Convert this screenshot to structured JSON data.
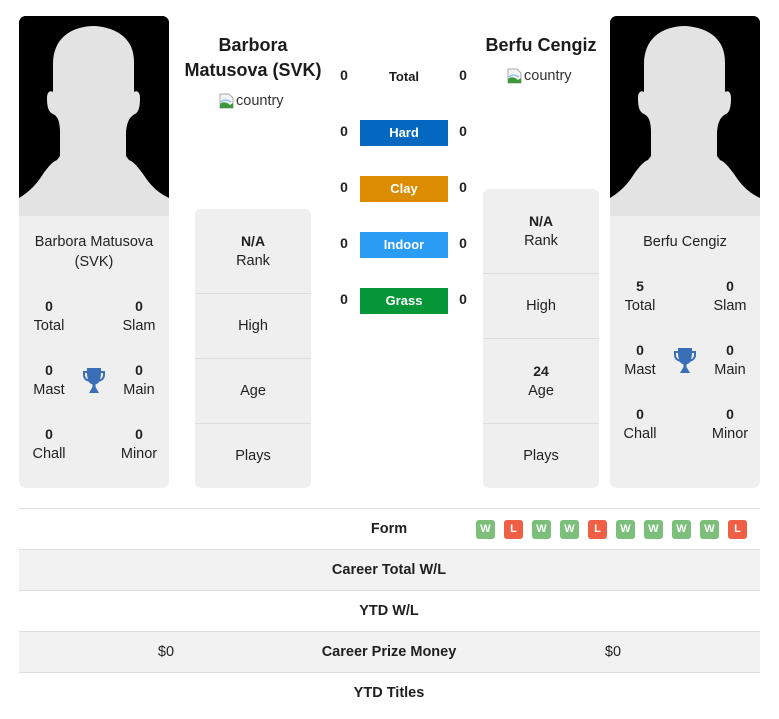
{
  "colors": {
    "hard": "#0568c0",
    "clay": "#dc8c00",
    "indoor": "#2b9cf4",
    "grass": "#059637",
    "win": "#7bbf7b",
    "loss": "#ee5f45",
    "trophy": "#3a6fb8"
  },
  "player_left": {
    "name_header": "Barbora Matusova (SVK)",
    "name_header_line1": "Barbora",
    "name_header_line2": "Matusova (SVK)",
    "flag_alt": "country",
    "card_name_line1": "Barbora Matusova",
    "card_name_line2": "(SVK)",
    "titles": {
      "total": {
        "value": "0",
        "label": "Total"
      },
      "slam": {
        "value": "0",
        "label": "Slam"
      },
      "mast": {
        "value": "0",
        "label": "Mast"
      },
      "main": {
        "value": "0",
        "label": "Main"
      },
      "chall": {
        "value": "0",
        "label": "Chall"
      },
      "minor": {
        "value": "0",
        "label": "Minor"
      }
    },
    "rank": {
      "value": "N/A",
      "label": "Rank"
    },
    "high": {
      "value": "",
      "label": "High"
    },
    "age": {
      "value": "",
      "label": "Age"
    },
    "plays": {
      "value": "",
      "label": "Plays"
    }
  },
  "player_right": {
    "name_header": "Berfu Cengiz",
    "flag_alt": "country",
    "card_name": "Berfu Cengiz",
    "titles": {
      "total": {
        "value": "5",
        "label": "Total"
      },
      "slam": {
        "value": "0",
        "label": "Slam"
      },
      "mast": {
        "value": "0",
        "label": "Mast"
      },
      "main": {
        "value": "0",
        "label": "Main"
      },
      "chall": {
        "value": "0",
        "label": "Chall"
      },
      "minor": {
        "value": "0",
        "label": "Minor"
      }
    },
    "rank": {
      "value": "N/A",
      "label": "Rank"
    },
    "high": {
      "value": "",
      "label": "High"
    },
    "age": {
      "value": "24",
      "label": "Age"
    },
    "plays": {
      "value": "",
      "label": "Plays"
    }
  },
  "h2h": {
    "total": {
      "label": "Total",
      "left": "0",
      "right": "0"
    },
    "hard": {
      "label": "Hard",
      "left": "0",
      "right": "0"
    },
    "clay": {
      "label": "Clay",
      "left": "0",
      "right": "0"
    },
    "indoor": {
      "label": "Indoor",
      "left": "0",
      "right": "0"
    },
    "grass": {
      "label": "Grass",
      "left": "0",
      "right": "0"
    }
  },
  "table": {
    "form": {
      "label": "Form",
      "right": [
        "W",
        "L",
        "W",
        "W",
        "L",
        "W",
        "W",
        "W",
        "W",
        "L"
      ]
    },
    "career_wl": {
      "label": "Career Total W/L",
      "left": "",
      "right": ""
    },
    "ytd_wl": {
      "label": "YTD W/L",
      "left": "",
      "right": ""
    },
    "prize": {
      "label": "Career Prize Money",
      "left": "$0",
      "right": "$0"
    },
    "ytd_titles": {
      "label": "YTD Titles",
      "left": "",
      "right": ""
    }
  }
}
